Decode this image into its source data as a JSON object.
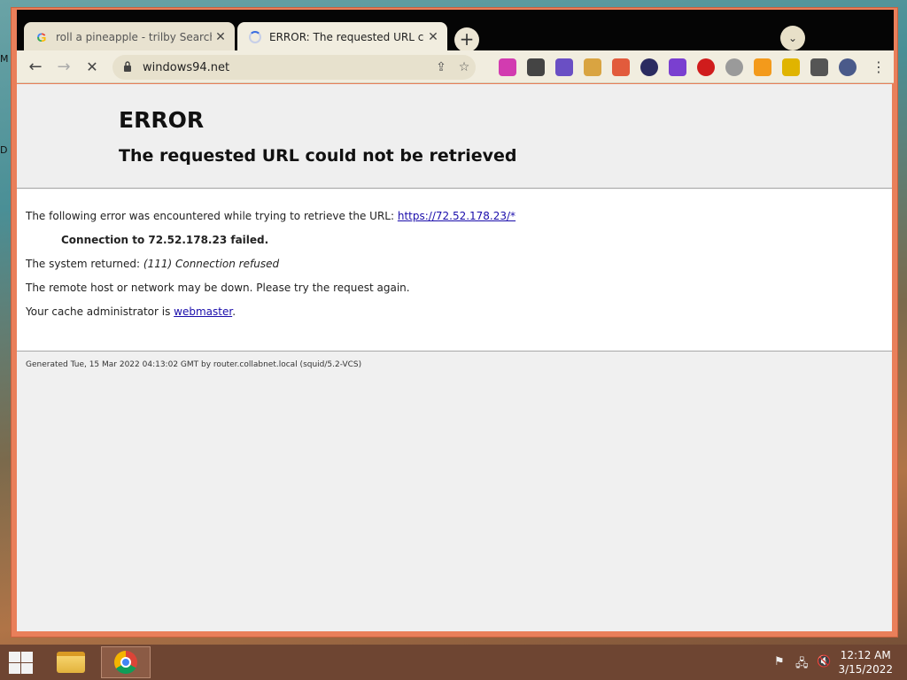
{
  "desktop": {
    "left_labels": [
      "M",
      "D"
    ]
  },
  "browser": {
    "tabs": [
      {
        "title": "roll a pineapple - trilby Search",
        "favicon": "google-g-icon",
        "active": false
      },
      {
        "title": "ERROR: The requested URL could",
        "favicon": "loading-spinner-icon",
        "active": true
      }
    ],
    "new_tab_label": "+",
    "tab_search_label": "⌄",
    "omnibox": {
      "url": "windows94.net"
    },
    "extensions": [
      {
        "name": "ext-rainbow-icon",
        "color": "#d23bb0"
      },
      {
        "name": "ext-hat-icon",
        "color": "#444444"
      },
      {
        "name": "ext-creature-icon",
        "color": "#6a4fc4"
      },
      {
        "name": "ext-doge-icon",
        "color": "#d9a441"
      },
      {
        "name": "ext-palette-icon",
        "color": "#e25b3c"
      },
      {
        "name": "ext-globe-icon",
        "color": "#2b2b60"
      },
      {
        "name": "ext-burst-icon",
        "color": "#7a3fd0"
      },
      {
        "name": "ext-block-icon",
        "color": "#d01c1c"
      },
      {
        "name": "ext-face-icon",
        "color": "#9a9a9a"
      },
      {
        "name": "ext-sun-icon",
        "color": "#f39a1b"
      },
      {
        "name": "ext-dancer-icon",
        "color": "#e0b400"
      },
      {
        "name": "extensions-puzzle-icon",
        "color": "#555555"
      },
      {
        "name": "profile-icon",
        "color": "#4a5a8a"
      }
    ]
  },
  "page": {
    "title": "ERROR",
    "subtitle": "The requested URL could not be retrieved",
    "line1_prefix": "The following error was encountered while trying to retrieve the URL: ",
    "line1_link": "https://72.52.178.23/*",
    "line2": "Connection to 72.52.178.23 failed.",
    "line3_prefix": "The system returned: ",
    "line3_detail": "(111) Connection refused",
    "line4": "The remote host or network may be down. Please try the request again.",
    "line5_prefix": "Your cache administrator is ",
    "line5_link": "webmaster",
    "line5_suffix": ".",
    "footer": "Generated Tue, 15 Mar 2022 04:13:02 GMT by router.collabnet.local (squid/5.2-VCS)"
  },
  "taskbar": {
    "apps": [
      {
        "name": "file-explorer",
        "active": false
      },
      {
        "name": "chrome",
        "active": true
      }
    ],
    "clock": {
      "time": "12:12 AM",
      "date": "3/15/2022"
    }
  }
}
